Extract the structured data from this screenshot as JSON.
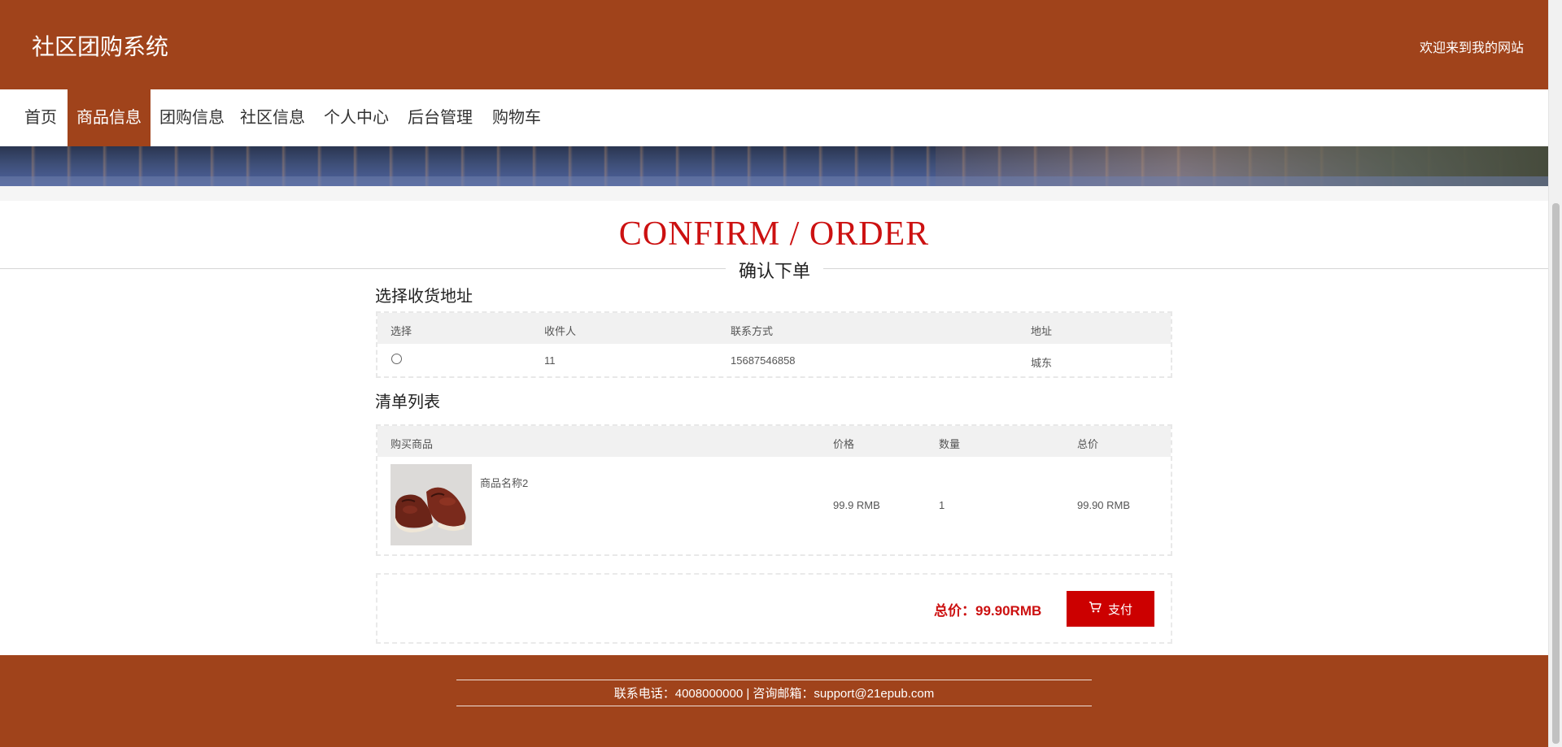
{
  "header": {
    "site_title": "社区团购系统",
    "welcome": "欢迎来到我的网站"
  },
  "nav": {
    "items": [
      "首页",
      "商品信息",
      "团购信息",
      "社区信息",
      "个人中心",
      "后台管理",
      "购物车"
    ],
    "active": "商品信息"
  },
  "page": {
    "title_en": "CONFIRM / ORDER",
    "title_cn": "确认下单"
  },
  "address_section": {
    "title": "选择收货地址",
    "headers": [
      "选择",
      "收件人",
      "联系方式",
      "地址"
    ],
    "rows": [
      {
        "selected": false,
        "recipient": "11",
        "phone": "15687546858",
        "address": "城东"
      }
    ]
  },
  "items_section": {
    "title": "清单列表",
    "headers": [
      "购买商品",
      "价格",
      "数量",
      "总价"
    ],
    "rows": [
      {
        "name": "商品名称2",
        "price": "99.9 RMB",
        "quantity": "1",
        "subtotal": "99.90 RMB",
        "image": "brown-leather-shoes"
      }
    ]
  },
  "summary": {
    "total_label": "总价：99.90RMB",
    "pay_label": "支付",
    "pay_icon": "cart-icon"
  },
  "footer": {
    "contact": "联系电话：4008000000 | 咨询邮箱：support@21epub.com"
  },
  "colors": {
    "brand": "#a0431b",
    "accent_red": "#cc1111",
    "button_red": "#cc0000"
  }
}
